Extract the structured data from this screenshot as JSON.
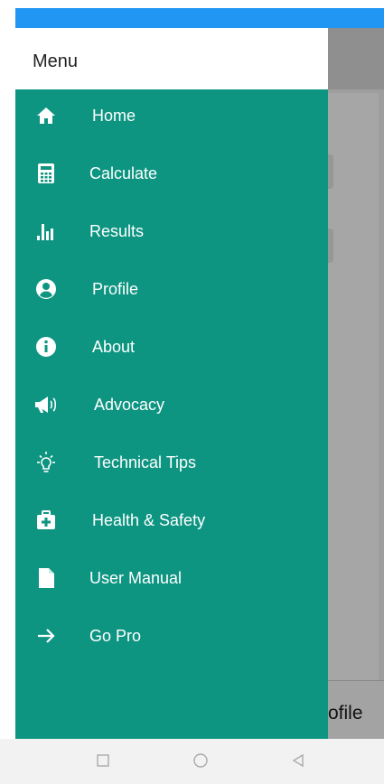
{
  "drawer": {
    "title": "Menu",
    "items": [
      {
        "label": "Home",
        "icon": "home-icon"
      },
      {
        "label": "Calculate",
        "icon": "calculator-icon"
      },
      {
        "label": "Results",
        "icon": "bar-chart-icon"
      },
      {
        "label": "Profile",
        "icon": "account-circle-icon"
      },
      {
        "label": "About",
        "icon": "info-icon"
      },
      {
        "label": "Advocacy",
        "icon": "megaphone-icon"
      },
      {
        "label": "Technical Tips",
        "icon": "lightbulb-icon"
      },
      {
        "label": "Health & Safety",
        "icon": "medical-kit-icon"
      },
      {
        "label": "User Manual",
        "icon": "document-icon"
      },
      {
        "label": "Go Pro",
        "icon": "arrow-right-icon"
      }
    ]
  },
  "background_app": {
    "bottom_tab_partial": "ofile"
  },
  "colors": {
    "status_bar": "#2196f3",
    "drawer_background": "#0e9582",
    "drawer_header": "#ffffff",
    "menu_text": "#ffffff"
  },
  "system_nav": {
    "buttons": [
      "recent-apps",
      "home",
      "back"
    ]
  }
}
